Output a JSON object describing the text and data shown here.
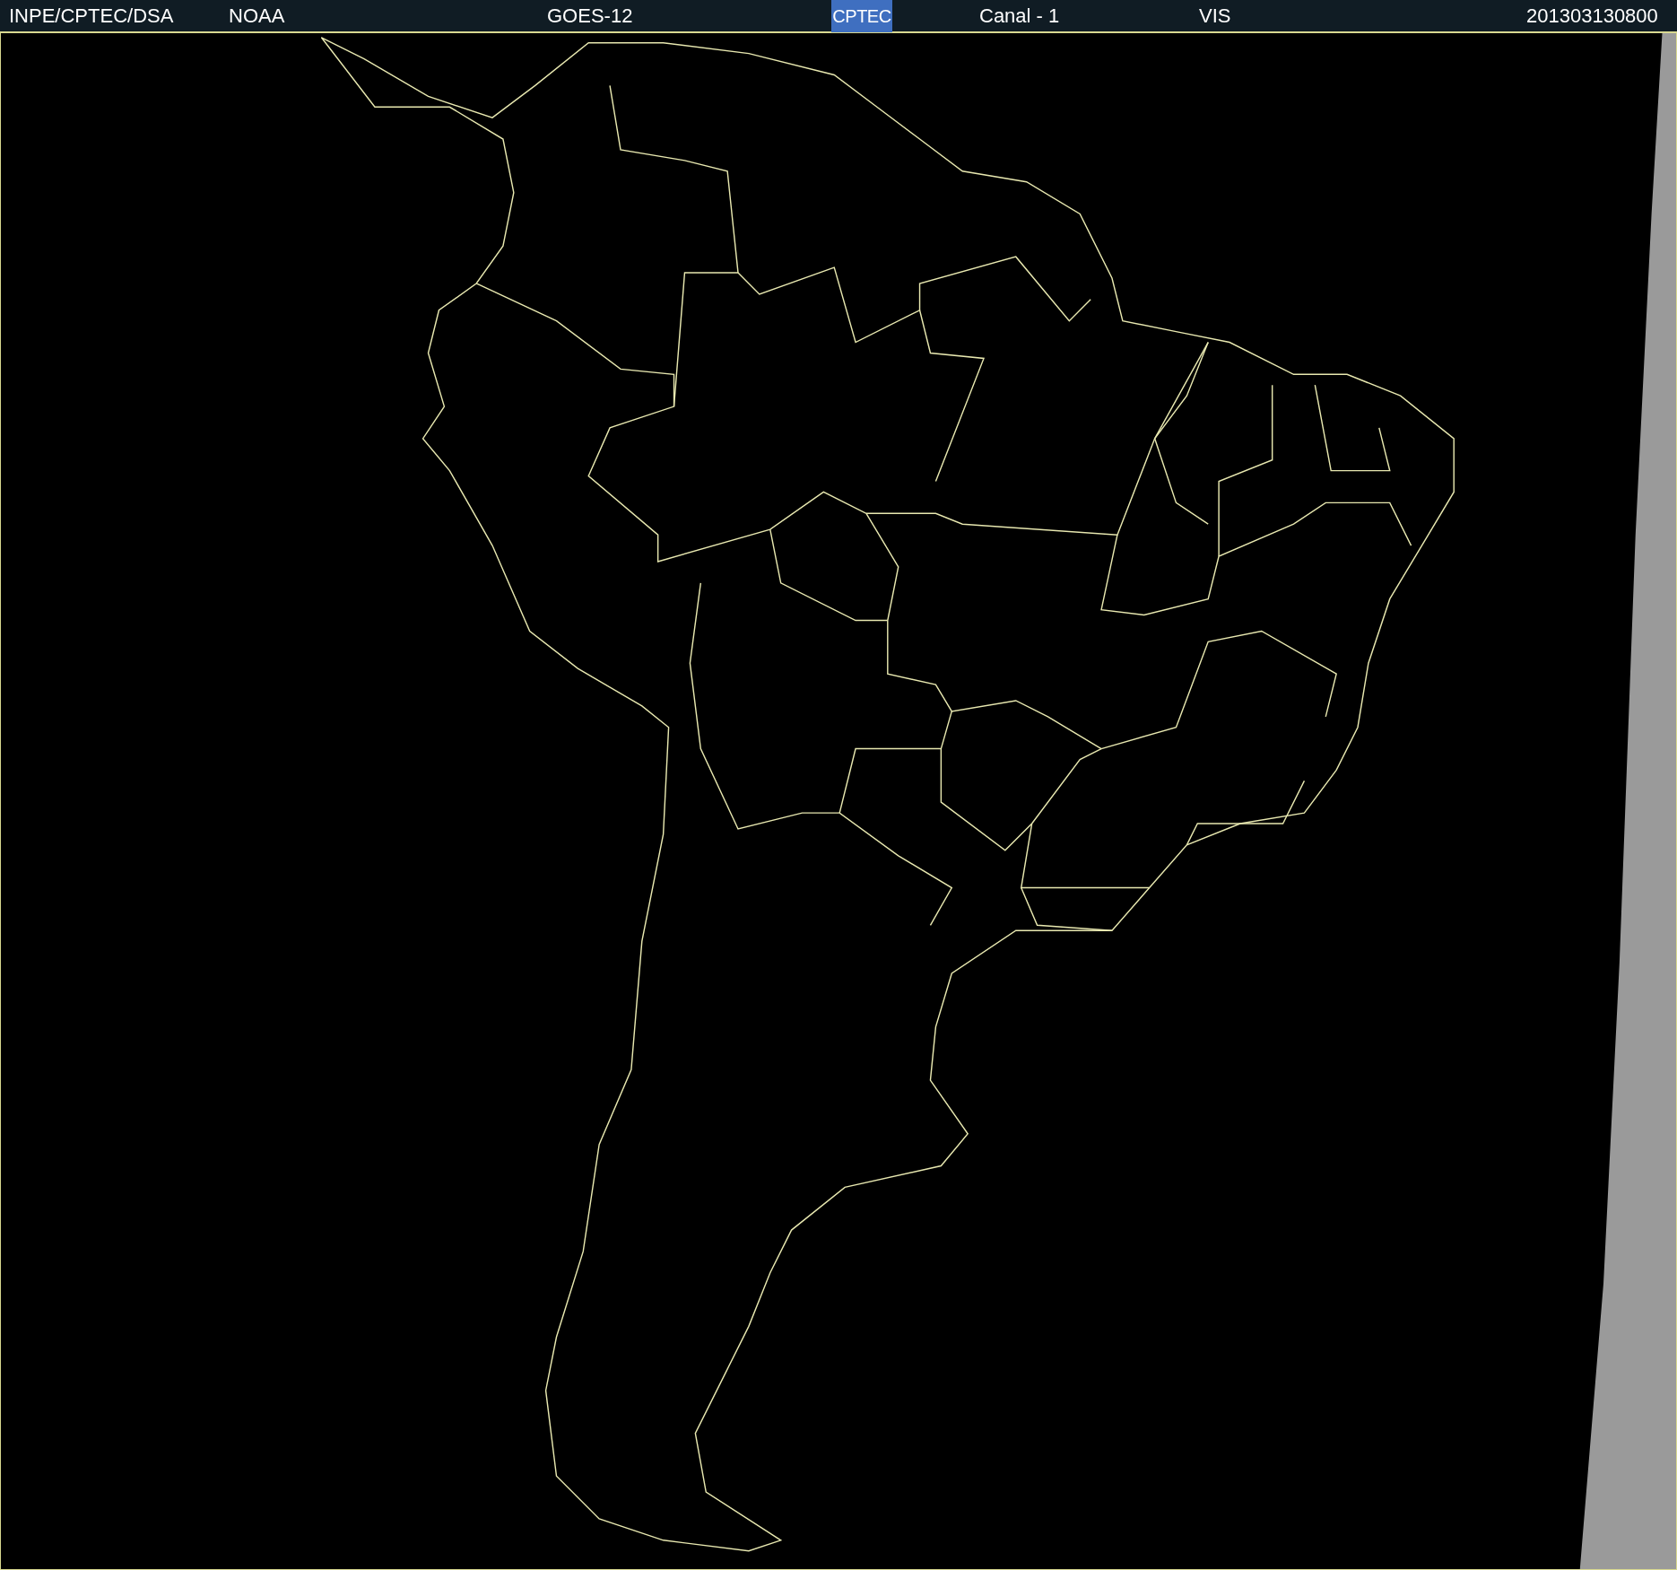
{
  "header": {
    "left": [
      {
        "text": "INPE/CPTEC/DSA"
      },
      {
        "text": "NOAA"
      },
      {
        "text": "GOES-12"
      }
    ],
    "logo": {
      "text": "CPTEC"
    },
    "right": [
      {
        "text": "Canal - 1"
      },
      {
        "text": "VIS"
      },
      {
        "text": "201303130800"
      }
    ]
  }
}
